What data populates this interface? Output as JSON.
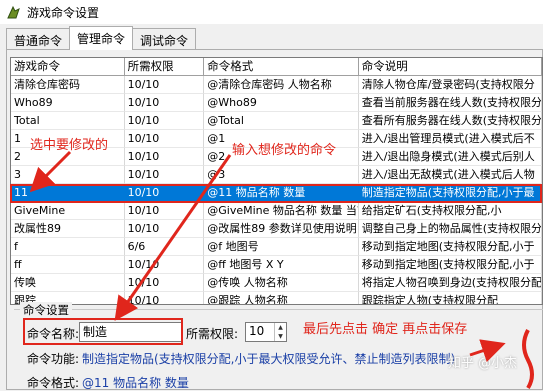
{
  "window": {
    "title": "游戏命令设置"
  },
  "tabs": [
    {
      "label": "普通命令"
    },
    {
      "label": "管理命令"
    },
    {
      "label": "调试命令"
    }
  ],
  "table": {
    "headers": [
      "游戏命令",
      "所需权限",
      "命令格式",
      "命令说明"
    ],
    "rows": [
      [
        "清除仓库密码",
        "10/10",
        "@清除仓库密码 人物名称",
        "清除人物仓库/登录密码(支持权限分"
      ],
      [
        "Who89",
        "10/10",
        "@Who89",
        "查看当前服务器在线人数(支持权限分"
      ],
      [
        "Total",
        "10/10",
        "@Total",
        "查看所有服务器在线人数(支持权限分"
      ],
      [
        "1",
        "10/10",
        "@1",
        "进入/退出管理员模式(进入模式后不"
      ],
      [
        "2",
        "10/10",
        "@2",
        "进入/退出隐身模式(进入模式后别人"
      ],
      [
        "3",
        "10/10",
        "@3",
        "进入/退出无敌模式(进入模式后人物"
      ],
      [
        "11",
        "10/10",
        "@11 物品名称 数量",
        "制造指定物品(支持权限分配,小于最"
      ],
      [
        "GiveMine",
        "10/10",
        "@GiveMine 物品名称 数量 当前",
        "给指定矿石(支持权限分配,小"
      ],
      [
        "改属性89",
        "10/10",
        "@改属性89 参数详见使用说明",
        "调整自己身上的物品属性(支持权限分"
      ],
      [
        "f",
        "6/6",
        "@f 地图号",
        "移动到指定地图(支持权限分配,小于"
      ],
      [
        "ff",
        "10/10",
        "@ff 地图号 X Y",
        "移动到指定地图(支持权限分配,小于"
      ],
      [
        "传唤",
        "10/10",
        "@传唤 人物名称",
        "将指定人物召唤到身边(支持权限分配"
      ],
      [
        "跟踪",
        "10/10",
        "@跟踪 人物名称",
        "跟踪指定人物(支持权限分配"
      ]
    ],
    "selected_row": 6
  },
  "settings": {
    "group_title": "命令设置",
    "name_label": "命令名称:",
    "name_value": "制造",
    "permission_label": "所需权限:",
    "permission_value": "10",
    "function_label": "命令功能:",
    "function_value": "制造指定物品(支持权限分配,小于最大权限受允许、禁止制造列表限制)",
    "format_label": "命令格式:",
    "format_value": "@11 物品名称 数量"
  },
  "annotations": {
    "select_hint": "选中要修改的",
    "input_hint": "输入想修改的命令",
    "save_hint": "最后先点击 确定 再点击保存"
  },
  "watermark": "知乎 @小杰",
  "colors": {
    "selection": "#0078d7",
    "annotation": "#e0261c",
    "info_text": "#1a3fa6"
  }
}
